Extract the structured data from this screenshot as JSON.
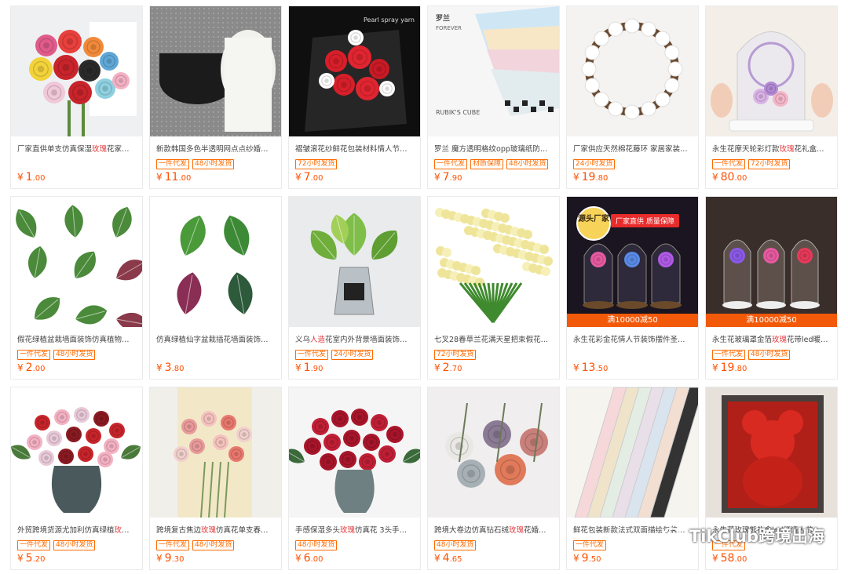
{
  "products": [
    {
      "title": [
        "厂家直供单支仿真保湿",
        "玫瑰",
        "花家居装..."
      ],
      "tags": [],
      "price_int": "1",
      "price_dec": ".00",
      "promo": "",
      "badge_circle": "",
      "badge_bar": ""
    },
    {
      "title": [
        "新款韩国多色半透明网点点纱婚庆鲜..."
      ],
      "tags": [
        "一件代发",
        "48小时发货"
      ],
      "price_int": "11",
      "price_dec": ".00",
      "promo": "",
      "badge_circle": "",
      "badge_bar": ""
    },
    {
      "title": [
        "褶皱滚花纱鲜花包装材料情人节韩式..."
      ],
      "tags": [
        "72小时发货"
      ],
      "price_int": "7",
      "price_dec": ".00",
      "promo": "",
      "badge_circle": "",
      "badge_bar": ""
    },
    {
      "title": [
        "罗兰 魔方透明格纹opp玻璃纸防水..."
      ],
      "tags": [
        "一件代发",
        "材质保障",
        "48小时发货"
      ],
      "price_int": "7",
      "price_dec": ".90",
      "promo": "",
      "badge_circle": "",
      "badge_bar": ""
    },
    {
      "title": [
        "厂家供应天然棉花藤环 家居家装艺..."
      ],
      "tags": [
        "24小时发货"
      ],
      "price_int": "19",
      "price_dec": ".80",
      "promo": "",
      "badge_circle": "",
      "badge_bar": ""
    },
    {
      "title": [
        "永生花摩天轮彩灯款",
        "玫瑰",
        "花礼盒情人..."
      ],
      "tags": [
        "一件代发",
        "72小时发货"
      ],
      "price_int": "80",
      "price_dec": ".00",
      "promo": "",
      "badge_circle": "",
      "badge_bar": ""
    },
    {
      "title": [
        "假花绿植盆栽墙面装饰仿真植物叶子..."
      ],
      "tags": [
        "一件代发",
        "48小时发货"
      ],
      "price_int": "2",
      "price_dec": ".00",
      "promo": "",
      "badge_circle": "",
      "badge_bar": ""
    },
    {
      "title": [
        "仿真绿植仙字盆栽插花墙面装饰叶子..."
      ],
      "tags": [],
      "price_int": "3",
      "price_dec": ".80",
      "promo": "",
      "badge_circle": "",
      "badge_bar": ""
    },
    {
      "title": [
        "义乌",
        "人造",
        "花室内外背景墙面装饰植物..."
      ],
      "tags": [
        "一件代发",
        "24小时发货"
      ],
      "price_int": "1",
      "price_dec": ".90",
      "promo": "",
      "badge_circle": "",
      "badge_bar": ""
    },
    {
      "title": [
        "七叉28春草兰花满天星把束假花花..."
      ],
      "tags": [
        "72小时发货"
      ],
      "price_int": "2",
      "price_dec": ".70",
      "promo": "",
      "badge_circle": "",
      "badge_bar": ""
    },
    {
      "title": [
        "永生花彩金花情人节装饰摆件圣诞节..."
      ],
      "tags": [],
      "price_int": "13",
      "price_dec": ".50",
      "promo": "满10000减50",
      "badge_circle": "源头厂家",
      "badge_bar": "厂家直供 质量保障"
    },
    {
      "title": [
        "永生花玻璃罩金箔",
        "玫瑰",
        "花带led暖灯..."
      ],
      "tags": [
        "一件代发",
        "48小时发货"
      ],
      "price_int": "19",
      "price_dec": ".80",
      "promo": "满10000减50",
      "badge_circle": "",
      "badge_bar": ""
    },
    {
      "title": [
        "外贸跨境货源尤加利仿真绿植",
        "玫瑰",
        "花..."
      ],
      "tags": [
        "一件代发",
        "48小时发货"
      ],
      "price_int": "5",
      "price_dec": ".20",
      "promo": "",
      "badge_circle": "",
      "badge_bar": ""
    },
    {
      "title": [
        "跨境复古焦边",
        "玫瑰",
        "仿真花单支春色系..."
      ],
      "tags": [
        "一件代发",
        "48小时发货"
      ],
      "price_int": "9",
      "price_dec": ".30",
      "promo": "",
      "badge_circle": "",
      "badge_bar": ""
    },
    {
      "title": [
        "手感保湿多头",
        "玫瑰",
        "仿真花 3头手感",
        "玫",
        "..."
      ],
      "tags": [
        "48小时发货"
      ],
      "price_int": "6",
      "price_dec": ".00",
      "promo": "",
      "badge_circle": "",
      "badge_bar": ""
    },
    {
      "title": [
        "跨境大卷边仿真钻石绒",
        "玫瑰",
        "花婚庆家..."
      ],
      "tags": [
        "48小时发货"
      ],
      "price_int": "4",
      "price_dec": ".65",
      "promo": "",
      "badge_circle": "",
      "badge_bar": ""
    },
    {
      "title": [
        "鲜花包装新款法式双面描绘包装纸..."
      ],
      "tags": [
        "一件代发"
      ],
      "price_int": "9",
      "price_dec": ".50",
      "promo": "",
      "badge_circle": "",
      "badge_bar": ""
    },
    {
      "title": [
        "永生花玫瑰熊礼盒led灯情人节..."
      ],
      "tags": [
        "一件代发"
      ],
      "price_int": "58",
      "price_dec": ".00",
      "promo": "",
      "badge_circle": "",
      "badge_bar": ""
    }
  ],
  "currency": "¥",
  "highlight_words": [
    "玫瑰",
    "人造",
    "玫"
  ],
  "watermark": {
    "text": "TikClub跨境出海",
    "icon": "wechat-icon"
  },
  "colors": {
    "price": "#ff5000",
    "tag": "#ff6a00",
    "highlight": "#e4393c",
    "promo_bg": "#f25a0a"
  }
}
